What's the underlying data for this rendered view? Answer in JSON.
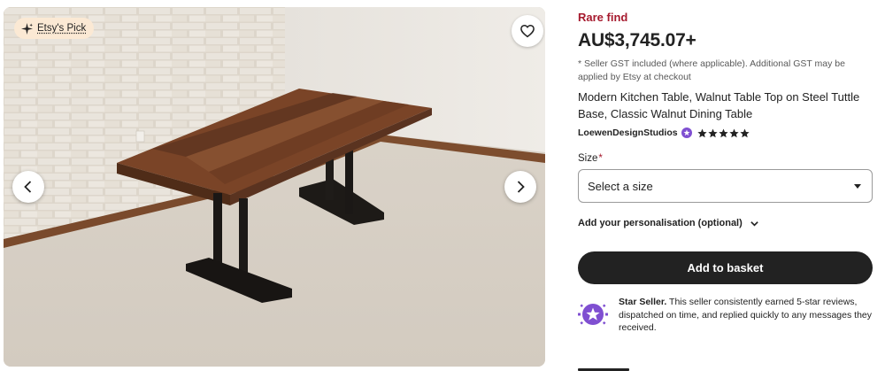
{
  "gallery": {
    "badge_label": "Etsy's Pick",
    "badge_icon": "sparkle-icon",
    "favorite_icon": "heart-icon",
    "prev_icon": "chevron-left-icon",
    "next_icon": "chevron-right-icon"
  },
  "listing": {
    "rare_label": "Rare find",
    "price": "AU$3,745.07+",
    "gst_note": "* Seller GST included (where applicable). Additional GST may be applied by Etsy at checkout",
    "title": "Modern Kitchen Table, Walnut Table Top on Steel Tuttle Base, Classic Walnut Dining Table",
    "shop_name": "LoewenDesignStudios",
    "star_rating": 5,
    "star_max": 5
  },
  "options": {
    "size_label": "Size",
    "required_mark": "*",
    "size_value": "Select a size",
    "personalisation_label": "Add your personalisation (optional)"
  },
  "actions": {
    "add_to_basket": "Add to basket"
  },
  "star_seller": {
    "heading": "Star Seller.",
    "description": " This seller consistently earned 5-star reviews, dispatched on time, and replied quickly to any messages they received."
  },
  "colors": {
    "accent_red": "#a61a2e",
    "seller_purple": "#7f4fd1",
    "button_dark": "#222222"
  }
}
